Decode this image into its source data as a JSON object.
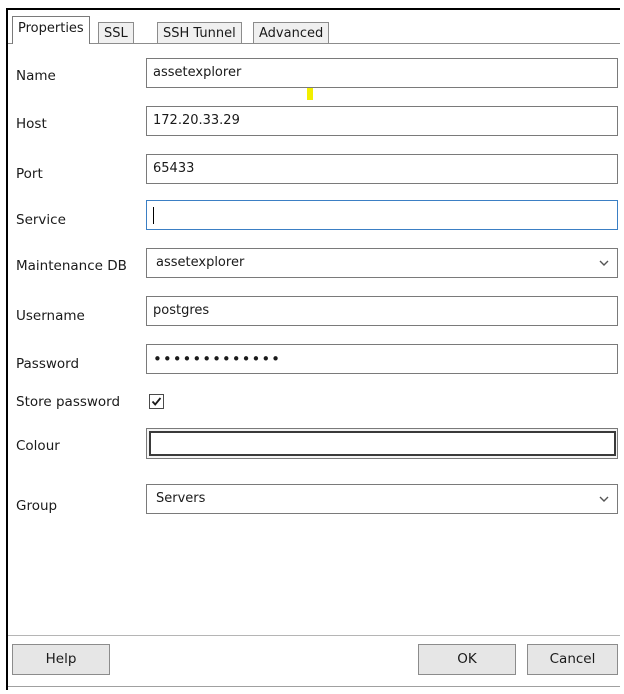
{
  "tabs": [
    {
      "label": "Properties",
      "active": true
    },
    {
      "label": "SSL",
      "active": false
    },
    {
      "label": "SSH Tunnel",
      "active": false
    },
    {
      "label": "Advanced",
      "active": false
    }
  ],
  "form": {
    "name": {
      "label": "Name",
      "value": "assetexplorer"
    },
    "host": {
      "label": "Host",
      "value": "172.20.33.29"
    },
    "port": {
      "label": "Port",
      "value": "65433"
    },
    "service": {
      "label": "Service",
      "value": ""
    },
    "maintenance_db": {
      "label": "Maintenance DB",
      "value": "assetexplorer"
    },
    "username": {
      "label": "Username",
      "value": "postgres"
    },
    "password": {
      "label": "Password",
      "value": "•••••••••••••"
    },
    "store_password": {
      "label": "Store password",
      "checked": true
    },
    "colour": {
      "label": "Colour",
      "value": ""
    },
    "group": {
      "label": "Group",
      "value": "Servers"
    }
  },
  "buttons": {
    "help": "Help",
    "ok": "OK",
    "cancel": "Cancel"
  },
  "icons": {
    "dropdown": "chevron-down-icon",
    "check": "checkmark-icon"
  },
  "colors": {
    "focus_border": "#3b7fc4",
    "marker": "#f2ef00"
  }
}
